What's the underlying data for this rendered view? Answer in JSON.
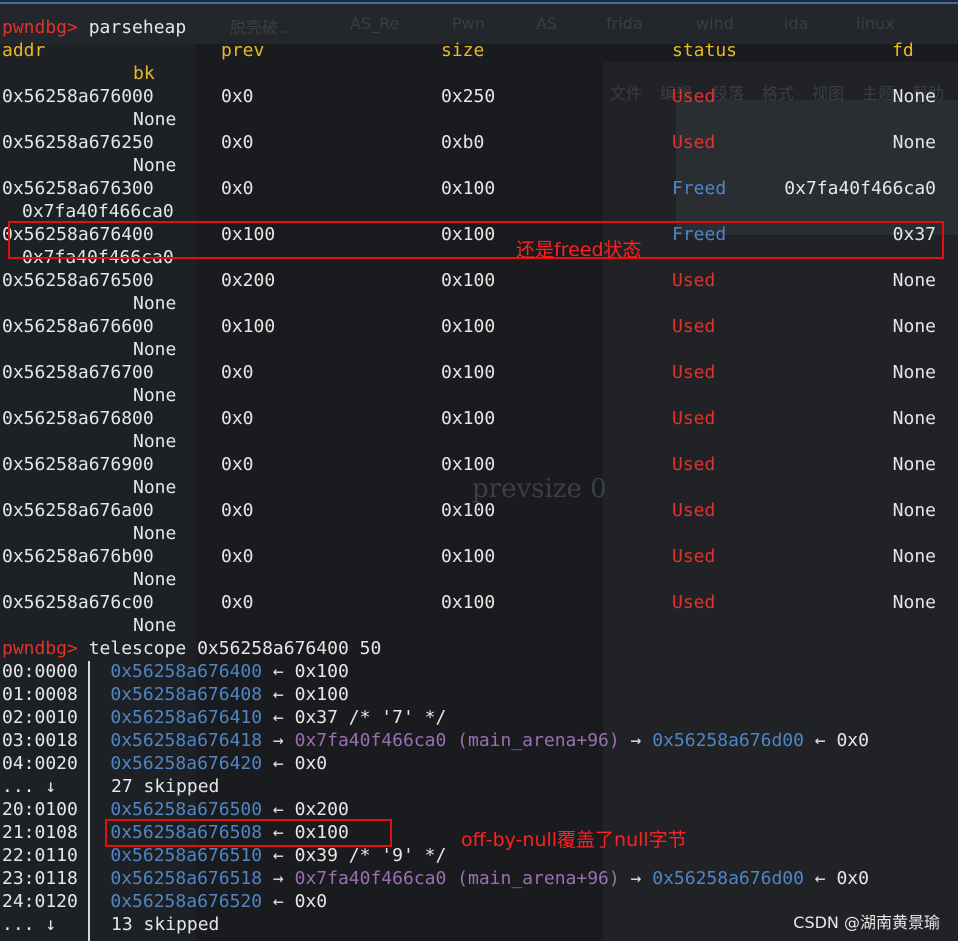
{
  "heap": {
    "prompt": "pwndbg>",
    "command": " parseheap",
    "headers": {
      "addr": "addr",
      "prev": "prev",
      "size": "size",
      "status": "status",
      "fd": "fd",
      "bk": "bk"
    },
    "rows": [
      {
        "addr": "0x56258a676000",
        "prev": "0x0",
        "size": "0x250",
        "status": "Used",
        "fd": "None",
        "bk": "None"
      },
      {
        "addr": "0x56258a676250",
        "prev": "0x0",
        "size": "0xb0",
        "status": "Used",
        "fd": "None",
        "bk": "None"
      },
      {
        "addr": "0x56258a676300",
        "prev": "0x0",
        "size": "0x100",
        "status": "Freed",
        "fd": "0x7fa40f466ca0",
        "bk": "0x7fa40f466ca0"
      },
      {
        "addr": "0x56258a676400",
        "prev": "0x100",
        "size": "0x100",
        "status": "Freed",
        "fd": "0x37",
        "bk": "0x7fa40f466ca0"
      },
      {
        "addr": "0x56258a676500",
        "prev": "0x200",
        "size": "0x100",
        "status": "Used",
        "fd": "None",
        "bk": "None"
      },
      {
        "addr": "0x56258a676600",
        "prev": "0x100",
        "size": "0x100",
        "status": "Used",
        "fd": "None",
        "bk": "None"
      },
      {
        "addr": "0x56258a676700",
        "prev": "0x0",
        "size": "0x100",
        "status": "Used",
        "fd": "None",
        "bk": "None"
      },
      {
        "addr": "0x56258a676800",
        "prev": "0x0",
        "size": "0x100",
        "status": "Used",
        "fd": "None",
        "bk": "None"
      },
      {
        "addr": "0x56258a676900",
        "prev": "0x0",
        "size": "0x100",
        "status": "Used",
        "fd": "None",
        "bk": "None"
      },
      {
        "addr": "0x56258a676a00",
        "prev": "0x0",
        "size": "0x100",
        "status": "Used",
        "fd": "None",
        "bk": "None"
      },
      {
        "addr": "0x56258a676b00",
        "prev": "0x0",
        "size": "0x100",
        "status": "Used",
        "fd": "None",
        "bk": "None"
      },
      {
        "addr": "0x56258a676c00",
        "prev": "0x0",
        "size": "0x100",
        "status": "Used",
        "fd": "None",
        "bk": "None"
      }
    ]
  },
  "telescope": {
    "prompt": "pwndbg>",
    "command": " telescope 0x56258a676400 50",
    "lines": [
      {
        "idx": "00:0000",
        "addr": "0x56258a676400",
        "arrow": " ← ",
        "val": "0x100",
        "rest": "",
        "chain": "",
        "tail": ""
      },
      {
        "idx": "01:0008",
        "addr": "0x56258a676408",
        "arrow": " ← ",
        "val": "0x100",
        "rest": "",
        "chain": "",
        "tail": ""
      },
      {
        "idx": "02:0010",
        "addr": "0x56258a676410",
        "arrow": " ← ",
        "val": "0x37 /* '7' */",
        "rest": "",
        "chain": "",
        "tail": ""
      },
      {
        "idx": "03:0018",
        "addr": "0x56258a676418",
        "arrow": " → ",
        "val": "",
        "rest": "0x7fa40f466ca0 (main_arena+96)",
        "chain": "0x56258a676d00",
        "tail": "0x0"
      },
      {
        "idx": "04:0020",
        "addr": "0x56258a676420",
        "arrow": " ← ",
        "val": "0x0",
        "rest": "",
        "chain": "",
        "tail": ""
      },
      {
        "idx": "20:0100",
        "addr": "0x56258a676500",
        "arrow": " ← ",
        "val": "0x200",
        "rest": "",
        "chain": "",
        "tail": ""
      },
      {
        "idx": "21:0108",
        "addr": "0x56258a676508",
        "arrow": " ← ",
        "val": "0x100",
        "rest": "",
        "chain": "",
        "tail": ""
      },
      {
        "idx": "22:0110",
        "addr": "0x56258a676510",
        "arrow": " ← ",
        "val": "0x39 /* '9' */",
        "rest": "",
        "chain": "",
        "tail": ""
      },
      {
        "idx": "23:0118",
        "addr": "0x56258a676518",
        "arrow": " → ",
        "val": "",
        "rest": "0x7fa40f466ca0 (main_arena+96)",
        "chain": "0x56258a676d00",
        "tail": "0x0"
      },
      {
        "idx": "24:0120",
        "addr": "0x56258a676520",
        "arrow": " ← ",
        "val": "0x0",
        "rest": "",
        "chain": "",
        "tail": ""
      }
    ],
    "skip1_idx": "... ↓",
    "skip1": "27 skipped",
    "skip2_idx": "... ↓",
    "skip2": "13 skipped"
  },
  "annotations": {
    "freed_note": "还是freed状态",
    "offbynull_note": "off-by-null覆盖了null字节"
  },
  "watermark": "CSDN @湖南黄景瑜",
  "background_ghost": {
    "tabs": [
      "脱壳破...",
      "AS_Re",
      "Pwn",
      "AS",
      "frida",
      "wind",
      "ida",
      "linux"
    ],
    "menu": [
      "文件",
      "编辑",
      "段落",
      "格式",
      "视图",
      "主题",
      "帮助"
    ],
    "prevsize": "prevsize 0"
  }
}
